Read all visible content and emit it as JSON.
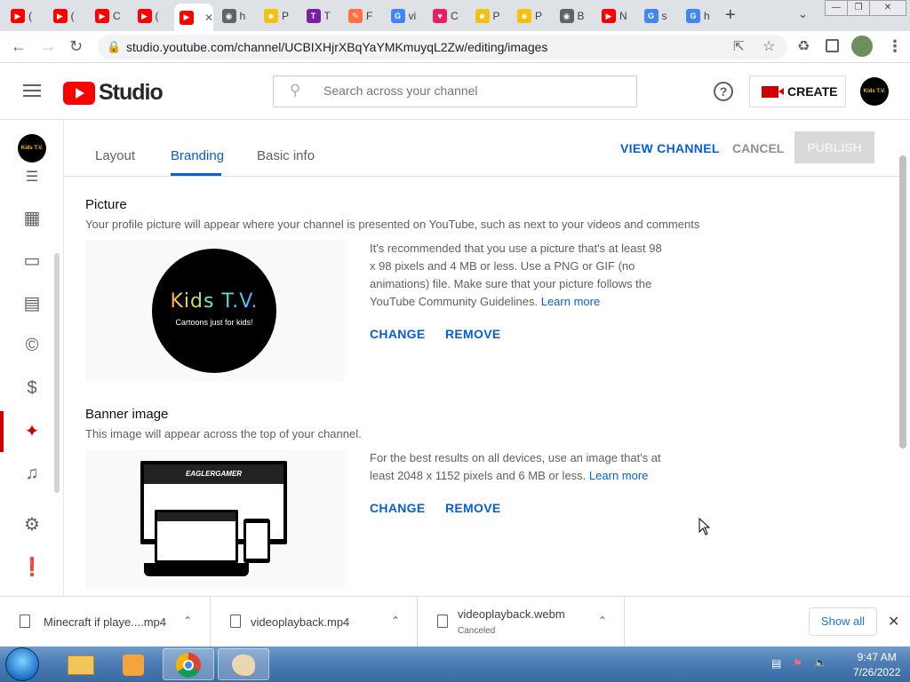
{
  "browser": {
    "tabs": [
      {
        "icon": "youtube-icon",
        "label": "(",
        "color": "#ff0000"
      },
      {
        "icon": "youtube-icon",
        "label": "(",
        "color": "#ff0000"
      },
      {
        "icon": "youtube-icon",
        "label": "C",
        "color": "#ff0000"
      },
      {
        "icon": "youtube-icon",
        "label": "(",
        "color": "#ff0000"
      },
      {
        "icon": "youtube-icon",
        "label": "",
        "color": "#ff0000",
        "active": true
      },
      {
        "icon": "globe-icon",
        "label": "h",
        "color": "#5f6368"
      },
      {
        "icon": "smiley-icon",
        "label": "P",
        "color": "#f4c20d"
      },
      {
        "icon": "t-icon",
        "label": "T",
        "color": "#7b1fa2"
      },
      {
        "icon": "paint-icon",
        "label": "F",
        "color": "#ff7043"
      },
      {
        "icon": "google-icon",
        "label": "vi",
        "color": "#4285f4"
      },
      {
        "icon": "heart-icon",
        "label": "C",
        "color": "#e91e63"
      },
      {
        "icon": "smiley-icon",
        "label": "P",
        "color": "#f4c20d"
      },
      {
        "icon": "smiley-icon",
        "label": "P",
        "color": "#f4c20d"
      },
      {
        "icon": "globe-icon",
        "label": "B",
        "color": "#5f6368"
      },
      {
        "icon": "youtube-icon",
        "label": "N",
        "color": "#ff0000"
      },
      {
        "icon": "google-icon",
        "label": "s",
        "color": "#4285f4"
      },
      {
        "icon": "google-icon",
        "label": "h",
        "color": "#4285f4"
      }
    ],
    "url": "studio.youtube.com/channel/UCBIXHjrXBqYaYMKmuyqL2Zw/editing/images"
  },
  "header": {
    "logo_text": "Studio",
    "search_placeholder": "Search across your channel",
    "create_label": "CREATE"
  },
  "channel": {
    "avatar_text": "Kids T.V."
  },
  "tabs": {
    "layout": "Layout",
    "branding": "Branding",
    "basic_info": "Basic info"
  },
  "actions": {
    "view_channel": "VIEW CHANNEL",
    "cancel": "CANCEL",
    "publish": "PUBLISH"
  },
  "picture": {
    "title": "Picture",
    "subtitle": "Your profile picture will appear where your channel is presented on YouTube, such as next to your videos and comments",
    "preview_title": "Kids T.V.",
    "preview_tagline": "Cartoons just for kids!",
    "note": "It's recommended that you use a picture that's at least 98 x 98 pixels and 4 MB or less. Use a PNG or GIF (no animations) file. Make sure that your picture follows the YouTube Community Guidelines.",
    "learn_more": "Learn more",
    "change": "CHANGE",
    "remove": "REMOVE"
  },
  "banner": {
    "title": "Banner image",
    "subtitle": "This image will appear across the top of your channel.",
    "preview_text": "EAGLERGAMER",
    "note": "For the best results on all devices, use an image that's at least 2048 x 1152 pixels and 6 MB or less.",
    "learn_more": "Learn more",
    "change": "CHANGE",
    "remove": "REMOVE"
  },
  "downloads": {
    "items": [
      {
        "name": "Minecraft if playe....mp4",
        "status": ""
      },
      {
        "name": "videoplayback.mp4",
        "status": ""
      },
      {
        "name": "videoplayback.webm",
        "status": "Canceled"
      }
    ],
    "show_all": "Show all"
  },
  "taskbar": {
    "time": "9:47 AM",
    "date": "7/26/2022"
  }
}
